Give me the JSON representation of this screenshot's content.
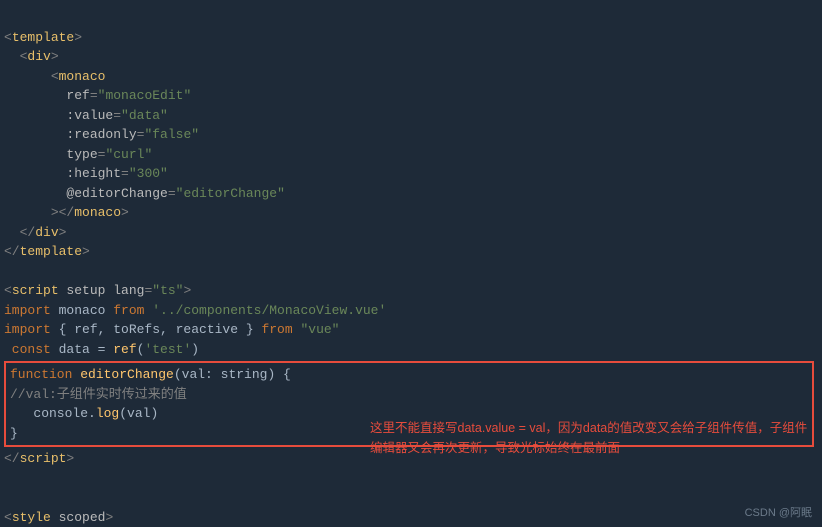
{
  "code": {
    "l1_open": "<",
    "l1_tag": "template",
    "l1_close": ">",
    "l2_open": "<",
    "l2_tag": "div",
    "l2_close": ">",
    "l3_open": "<",
    "l3_tag": "monaco",
    "l4_attr": "ref",
    "l4_eq": "=",
    "l4_val": "\"monacoEdit\"",
    "l5_attr": ":value",
    "l5_eq": "=",
    "l5_val": "\"data\"",
    "l6_attr": ":readonly",
    "l6_eq": "=",
    "l6_val": "\"false\"",
    "l7_attr": "type",
    "l7_eq": "=",
    "l7_val": "\"curl\"",
    "l8_attr": ":height",
    "l8_eq": "=",
    "l8_val": "\"300\"",
    "l9_attr": "@editorChange",
    "l9_eq": "=",
    "l9_val": "\"editorChange\"",
    "l10_open": "></",
    "l10_tag": "monaco",
    "l10_close": ">",
    "l11_open": "</",
    "l11_tag": "div",
    "l11_close": ">",
    "l12_open": "</",
    "l12_tag": "template",
    "l12_close": ">",
    "l14_open": "<",
    "l14_tag": "script",
    "l14_a1": " setup ",
    "l14_a2": "lang",
    "l14_eq": "=",
    "l14_val": "\"ts\"",
    "l14_close": ">",
    "l15_kw": "import ",
    "l15_n": "monaco ",
    "l15_from": "from ",
    "l15_path": "'../components/MonacoView.vue'",
    "l16_kw": "import ",
    "l16_n": "{ ref, toRefs, reactive } ",
    "l16_from": "from ",
    "l16_path": "\"vue\"",
    "l17_kw": " const ",
    "l17_n": "data = ",
    "l17_fn": "ref",
    "l17_n2": "(",
    "l17_val": "'test'",
    "l17_n3": ")",
    "l18_kw": "function ",
    "l18_fn": "editorChange",
    "l18_sig": "(val: string) {",
    "l19": "//val:子组件实时传过来的值",
    "l20_n": "   console.",
    "l20_fn": "log",
    "l20_n2": "(val)",
    "l21": "}",
    "l22_open": "</",
    "l22_tag": "script",
    "l22_close": ">",
    "l24_open": "<",
    "l24_tag": "style",
    "l24_a": " scoped",
    "l24_close": ">"
  },
  "annotation": "这里不能直接写data.value = val，因为data的值改变又会给子组件传值，子组件编辑器又会再次更新，导致光标始终在最前面",
  "watermark": "CSDN @阿眠"
}
